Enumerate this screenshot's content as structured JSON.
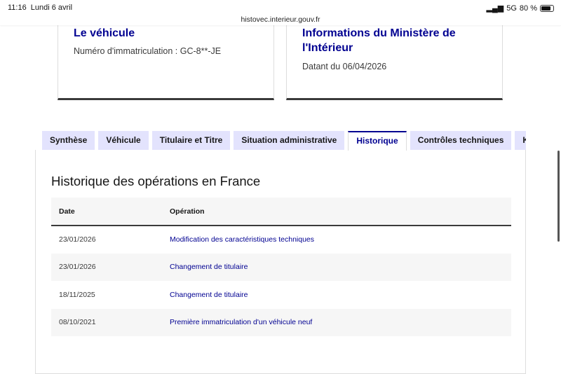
{
  "status_bar": {
    "time": "11:16",
    "date": "Lundi 6 avril",
    "network": "5G",
    "battery": "80 %",
    "url": "histovec.interieur.gouv.fr"
  },
  "cards": [
    {
      "title": "Le véhicule",
      "text": "Numéro d'immatriculation : GC-8**-JE"
    },
    {
      "title": "Informations du Ministère de l'Intérieur",
      "text": "Datant du 06/04/2026"
    }
  ],
  "tabs": [
    "Synthèse",
    "Véhicule",
    "Titulaire et Titre",
    "Situation administrative",
    "Historique",
    "Contrôles techniques",
    "Kilométrage"
  ],
  "active_tab": "Historique",
  "section_title": "Historique des opérations en France",
  "table": {
    "headers": [
      "Date",
      "Opération"
    ],
    "rows": [
      [
        "23/01/2026",
        "Modification des caractéristiques techniques"
      ],
      [
        "23/01/2026",
        "Changement de titulaire"
      ],
      [
        "18/11/2025",
        "Changement de titulaire"
      ],
      [
        "08/10/2021",
        "Première immatriculation d'un véhicule neuf"
      ]
    ]
  }
}
